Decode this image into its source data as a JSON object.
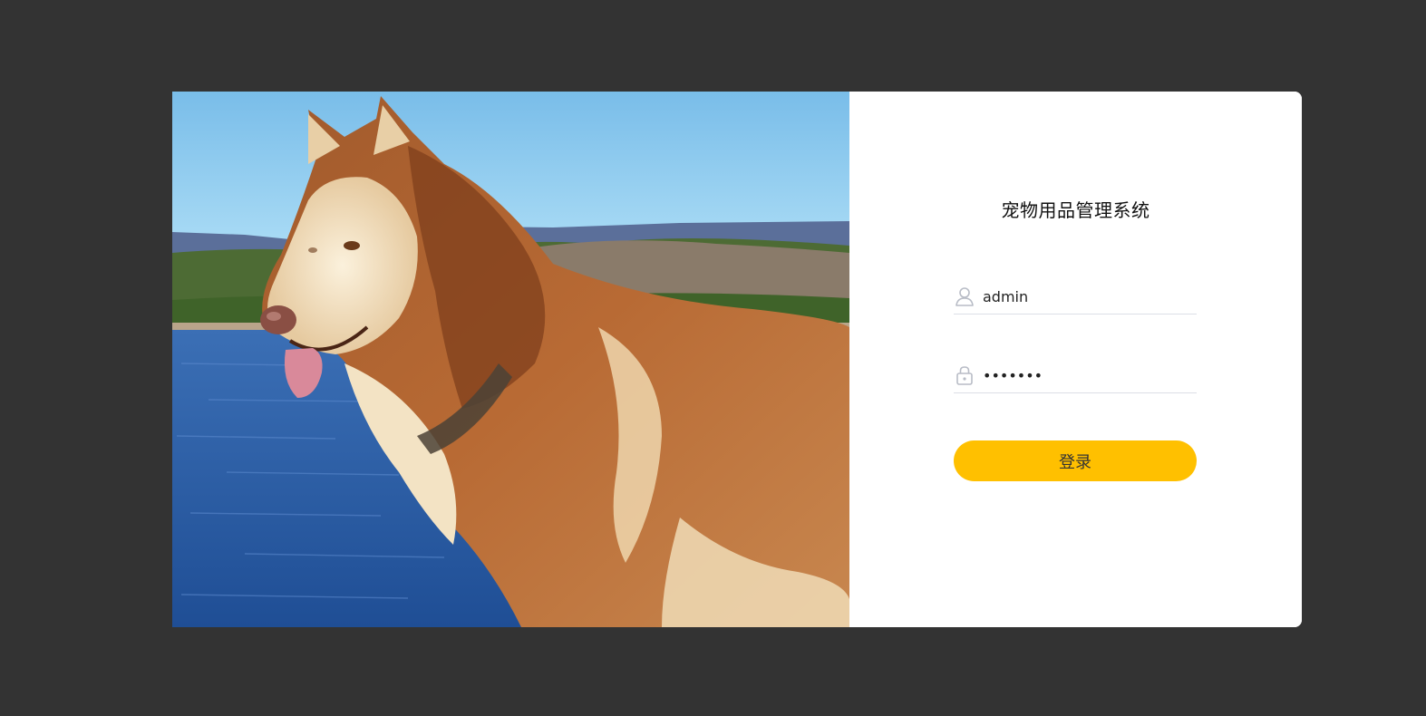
{
  "app": {
    "title": "宠物用品管理系统"
  },
  "hero": {
    "image_subject": "husky-dog-by-lake"
  },
  "form": {
    "username_value": "admin",
    "password_value": "1234567",
    "login_label": "登录",
    "user_icon": "user-icon",
    "lock_icon": "lock-icon"
  },
  "colors": {
    "page_background": "#333333",
    "panel_background": "#ffffff",
    "button": "#ffc000",
    "icon": "#b8bcc6"
  }
}
